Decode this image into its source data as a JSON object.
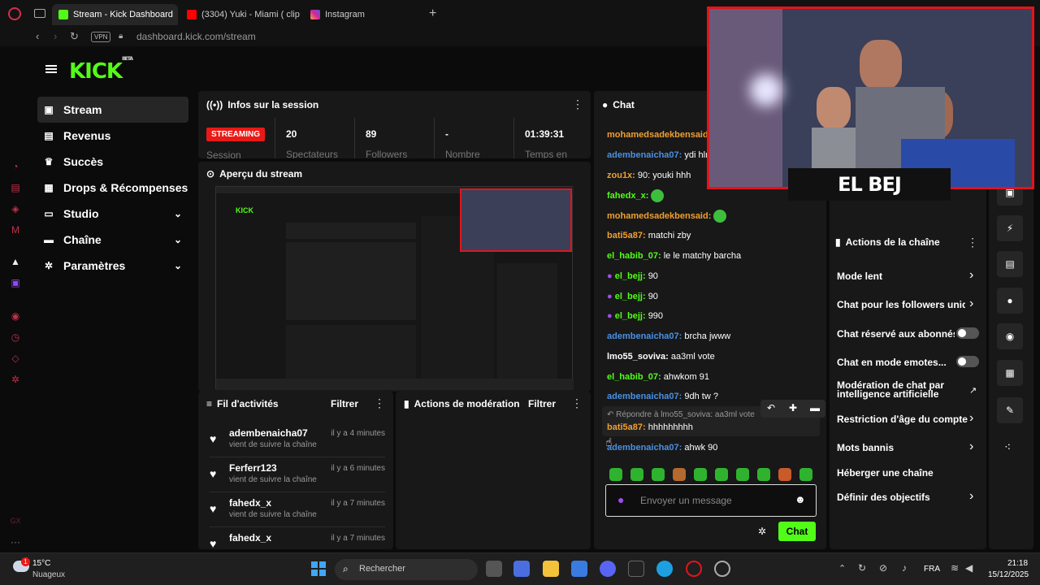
{
  "browser": {
    "tabs": [
      {
        "label": "Stream - Kick Dashboard",
        "icon": "kick-icon"
      },
      {
        "label": "(3304) Yuki - Miami ( clip",
        "icon": "youtube-icon"
      },
      {
        "label": "Instagram",
        "icon": "instagram-icon"
      }
    ],
    "vpn_label": "VPN",
    "url": "dashboard.kick.com/stream"
  },
  "header": {
    "logo": "KICK",
    "logo_sup": "BETA"
  },
  "sidebar": {
    "items": [
      {
        "label": "Stream",
        "icon": "video-icon"
      },
      {
        "label": "Revenus",
        "icon": "chart-icon"
      },
      {
        "label": "Succès",
        "icon": "trophy-icon"
      },
      {
        "label": "Drops & Récompenses",
        "icon": "gift-icon"
      },
      {
        "label": "Studio",
        "icon": "studio-icon"
      },
      {
        "label": "Chaîne",
        "icon": "tv-icon"
      },
      {
        "label": "Paramètres",
        "icon": "gear-icon"
      }
    ]
  },
  "session": {
    "title": "Infos sur la session",
    "badge": "STREAMING",
    "stats": [
      {
        "value": "20",
        "label": "Spectateurs"
      },
      {
        "value": "89",
        "label": "Followers"
      },
      {
        "value": "-",
        "label": "Nombre"
      },
      {
        "value": "01:39:31",
        "label": "Temps en"
      }
    ],
    "extra_label": "Session"
  },
  "preview": {
    "title": "Aperçu du stream"
  },
  "activity": {
    "title": "Fil d'activités",
    "filter": "Filtrer",
    "items": [
      {
        "name": "adembenaicha07",
        "time": "il y a 4 minutes",
        "sub": "vient de suivre la chaîne"
      },
      {
        "name": "Ferferr123",
        "time": "il y a 6 minutes",
        "sub": "vient de suivre la chaîne"
      },
      {
        "name": "fahedx_x",
        "time": "il y a 7 minutes",
        "sub": "vient de suivre la chaîne"
      },
      {
        "name": "fahedx_x",
        "time": "il y a 7 minutes",
        "sub": ""
      }
    ]
  },
  "moderation": {
    "title": "Actions de modération",
    "filter": "Filtrer"
  },
  "chat": {
    "title": "Chat",
    "messages": [
      {
        "user": "mohamedsadekbensaid:",
        "text": "",
        "color": "#f0a030"
      },
      {
        "user": "adembenaicha07:",
        "text": "ydi hlm",
        "color": "#4a90e2"
      },
      {
        "user": "zou1x:",
        "text": "90: youki hhh",
        "color": "#f0a030"
      },
      {
        "user": "fahedx_x:",
        "text": "",
        "color": "#53fc18"
      },
      {
        "user": "mohamedsadekbensaid:",
        "text": "",
        "color": "#f0a030"
      },
      {
        "user": "bati5a87:",
        "text": "matchi zby",
        "color": "#f0a030"
      },
      {
        "user": "el_habib_07:",
        "text": "le le matchy barcha",
        "color": "#53fc18"
      },
      {
        "user": "el_bejj:",
        "text": "90",
        "color": "#53fc18"
      },
      {
        "user": "el_bejj:",
        "text": "90",
        "color": "#53fc18"
      },
      {
        "user": "el_bejj:",
        "text": "990",
        "color": "#53fc18"
      },
      {
        "user": "adembenaicha07:",
        "text": "brcha jwww",
        "color": "#4a90e2"
      },
      {
        "user": "lmo55_soviva:",
        "text": "aa3ml vote",
        "color": "#ffffff"
      },
      {
        "user": "el_habib_07:",
        "text": "ahwkom 91",
        "color": "#53fc18"
      },
      {
        "user": "adembenaicha07:",
        "text": "9dh tw ?",
        "color": "#4a90e2"
      }
    ],
    "reply_hint": "Répondre à lmo55_soviva: aa3ml vote",
    "reply_user": "bati5a87:",
    "reply_text": "hhhhhhhhh",
    "last_user": "adembenaicha07:",
    "last_text": "ahwk 90",
    "input_placeholder": "Envoyer un message",
    "send_label": "Chat"
  },
  "channel_actions": {
    "title": "Actions de la chaîne",
    "items": [
      {
        "label": "Mode lent",
        "control": "chevron"
      },
      {
        "label": "Chat pour les followers uniquement",
        "control": "chevron"
      },
      {
        "label": "Chat réservé aux abonnés",
        "control": "toggle"
      },
      {
        "label": "Chat en mode emotes...",
        "control": "toggle"
      },
      {
        "label": "Modération de chat par intelligence artificielle",
        "control": "external"
      },
      {
        "label": "Restriction d'âge du compte",
        "control": "chevron"
      },
      {
        "label": "Mots bannis",
        "control": "chevron"
      },
      {
        "label": "Héberger une chaîne",
        "control": "none"
      },
      {
        "label": "Définir des objectifs",
        "control": "chevron"
      }
    ]
  },
  "webcam": {
    "label": "EL BEJ"
  },
  "taskbar": {
    "weather_temp": "15°C",
    "weather_desc": "Nuageux",
    "weather_badge": "1",
    "search_placeholder": "Rechercher",
    "lang": "FRA",
    "time": "21:18",
    "date": "15/12/2025"
  },
  "colors": {
    "accent": "#53fc18",
    "live": "#e91916",
    "cam_border": "#e1141c"
  }
}
